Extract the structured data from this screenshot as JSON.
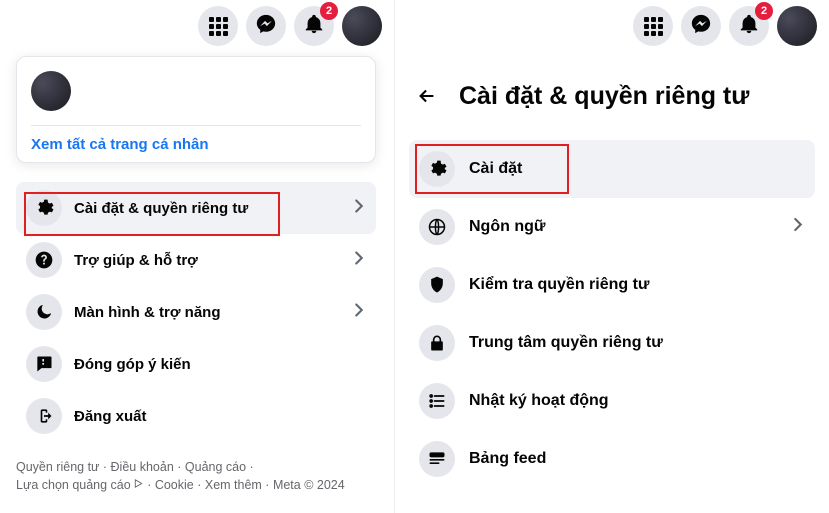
{
  "left": {
    "notifications_badge": "2",
    "link_all_profiles": "Xem tất cả trang cá nhân",
    "menu": [
      {
        "id": "settings-privacy",
        "label": "Cài đặt & quyền riêng tư",
        "icon": "gear",
        "chevron": true,
        "selected": true,
        "highlighted": true
      },
      {
        "id": "help-support",
        "label": "Trợ giúp & hỗ trợ",
        "icon": "question",
        "chevron": true
      },
      {
        "id": "display-accessibility",
        "label": "Màn hình & trợ năng",
        "icon": "moon",
        "chevron": true
      },
      {
        "id": "feedback",
        "label": "Đóng góp ý kiến",
        "icon": "feedback"
      },
      {
        "id": "logout",
        "label": "Đăng xuất",
        "icon": "logout"
      }
    ],
    "footer": [
      "Quyền riêng tư",
      "Điều khoản",
      "Quảng cáo",
      {
        "text_before": "Lựa chọn quảng cáo",
        "adchoice": true
      },
      "Cookie",
      "Xem thêm",
      "Meta © 2024"
    ]
  },
  "right": {
    "notifications_badge": "2",
    "title": "Cài đặt & quyền riêng tư",
    "menu": [
      {
        "id": "settings",
        "label": "Cài đặt",
        "icon": "gear",
        "selected": true,
        "highlighted": true
      },
      {
        "id": "language",
        "label": "Ngôn ngữ",
        "icon": "globe",
        "chevron": true
      },
      {
        "id": "privacy-checkup",
        "label": "Kiểm tra quyền riêng tư",
        "icon": "lock-shield"
      },
      {
        "id": "privacy-center",
        "label": "Trung tâm quyền riêng tư",
        "icon": "lock"
      },
      {
        "id": "activity-log",
        "label": "Nhật ký hoạt động",
        "icon": "list"
      },
      {
        "id": "feed",
        "label": "Bảng feed",
        "icon": "feed"
      }
    ]
  }
}
